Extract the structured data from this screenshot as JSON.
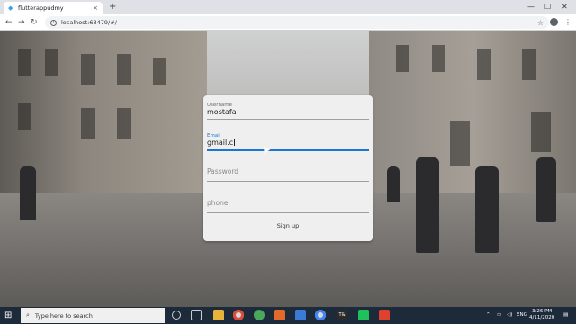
{
  "browser": {
    "tab_title": "flutterappudmy",
    "tab_close": "×",
    "new_tab": "+",
    "window_controls": [
      "—",
      "☐",
      "✕"
    ],
    "address": "localhost:63479/#/"
  },
  "form": {
    "username_label": "Username",
    "username_value": "mostafa",
    "email_label": "Email",
    "email_value": "gmail.c",
    "password_placeholder": "Password",
    "phone_placeholder": "phone",
    "signup_label": "Sign up"
  },
  "taskbar": {
    "search_placeholder": "Type here to search",
    "language": "ENG",
    "time": "3:26 PM",
    "date": "4/11/2020"
  },
  "colors": {
    "focus": "#1976d2",
    "taskbar": "#1c2a3a"
  }
}
